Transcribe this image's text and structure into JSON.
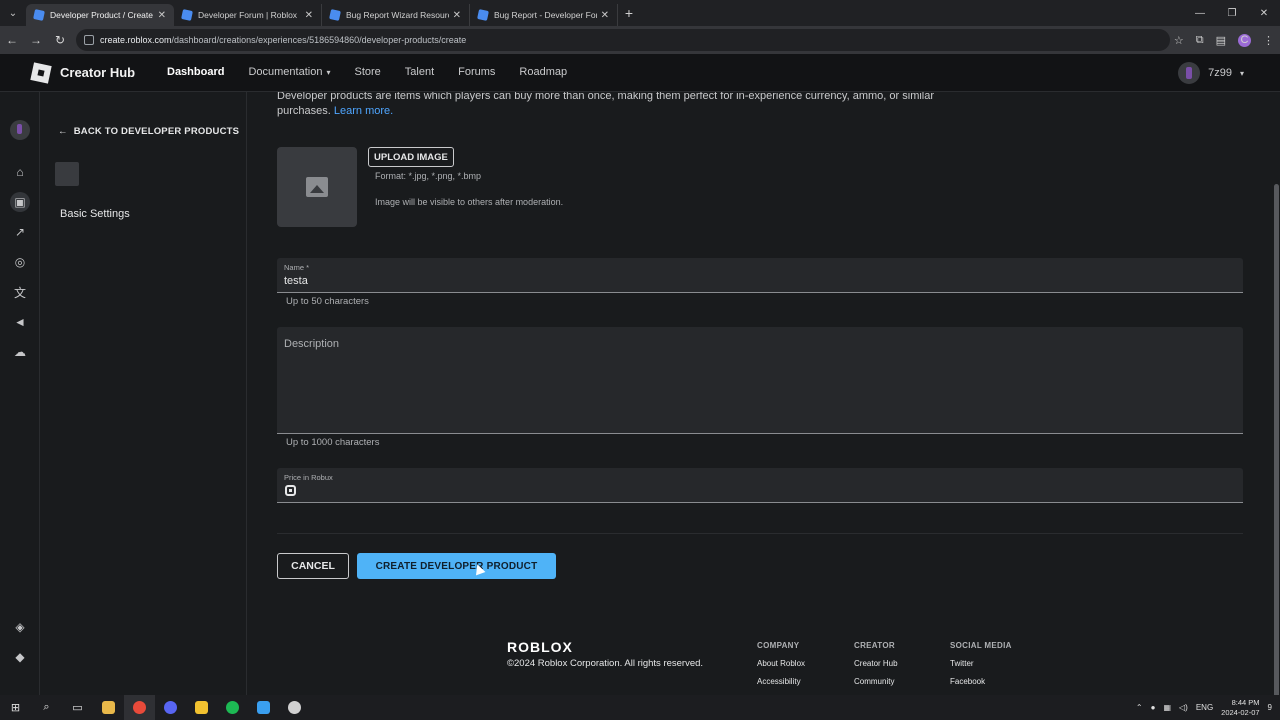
{
  "browser": {
    "tabs": [
      {
        "title": "Developer Product / Create De",
        "active": true
      },
      {
        "title": "Developer Forum | Roblox",
        "active": false
      },
      {
        "title": "Bug Report Wizard Resources",
        "active": false
      },
      {
        "title": "Bug Report - Developer Forum",
        "active": false
      }
    ],
    "url_host": "create.roblox.com",
    "url_path": "/dashboard/creations/experiences/5186594860/developer-products/create",
    "profile_initial": "C"
  },
  "header": {
    "title": "Creator Hub",
    "nav": [
      "Dashboard",
      "Documentation",
      "Store",
      "Talent",
      "Forums",
      "Roadmap"
    ],
    "dropdown_caret": "▾",
    "username": "7z99"
  },
  "sidebar": {
    "back_label": "BACK TO DEVELOPER PRODUCTS",
    "item": "Basic Settings"
  },
  "form": {
    "intro_text": "Developer products are items which players can buy more than once, making them perfect for in-experience currency, ammo, or similar purchases.",
    "learn_more": "Learn more.",
    "upload_label": "UPLOAD IMAGE",
    "format_hint": "Format: *.jpg, *.png, *.bmp",
    "moderation_hint": "Image will be visible to others after moderation.",
    "name_label": "Name *",
    "name_value": "testa",
    "name_helper": "Up to 50 characters",
    "description_label": "Description",
    "description_helper": "Up to 1000 characters",
    "price_label": "Price in Robux",
    "cancel_label": "CANCEL",
    "create_label": "CREATE DEVELOPER PRODUCT"
  },
  "footer": {
    "logo": "ROBLOX",
    "copyright": "©2024 Roblox Corporation. All rights reserved.",
    "columns": [
      {
        "heading": "COMPANY",
        "links": [
          "About Roblox",
          "Accessibility"
        ]
      },
      {
        "heading": "CREATOR",
        "links": [
          "Creator Hub",
          "Community"
        ]
      },
      {
        "heading": "SOCIAL MEDIA",
        "links": [
          "Twitter",
          "Facebook"
        ]
      }
    ]
  },
  "taskbar": {
    "language": "ENG",
    "time": "8:44 PM",
    "date": "2024-02-07",
    "notification_count": "9"
  },
  "colors": {
    "accent": "#4fb3f7",
    "link": "#4fa6ff",
    "background": "#191b1d"
  }
}
